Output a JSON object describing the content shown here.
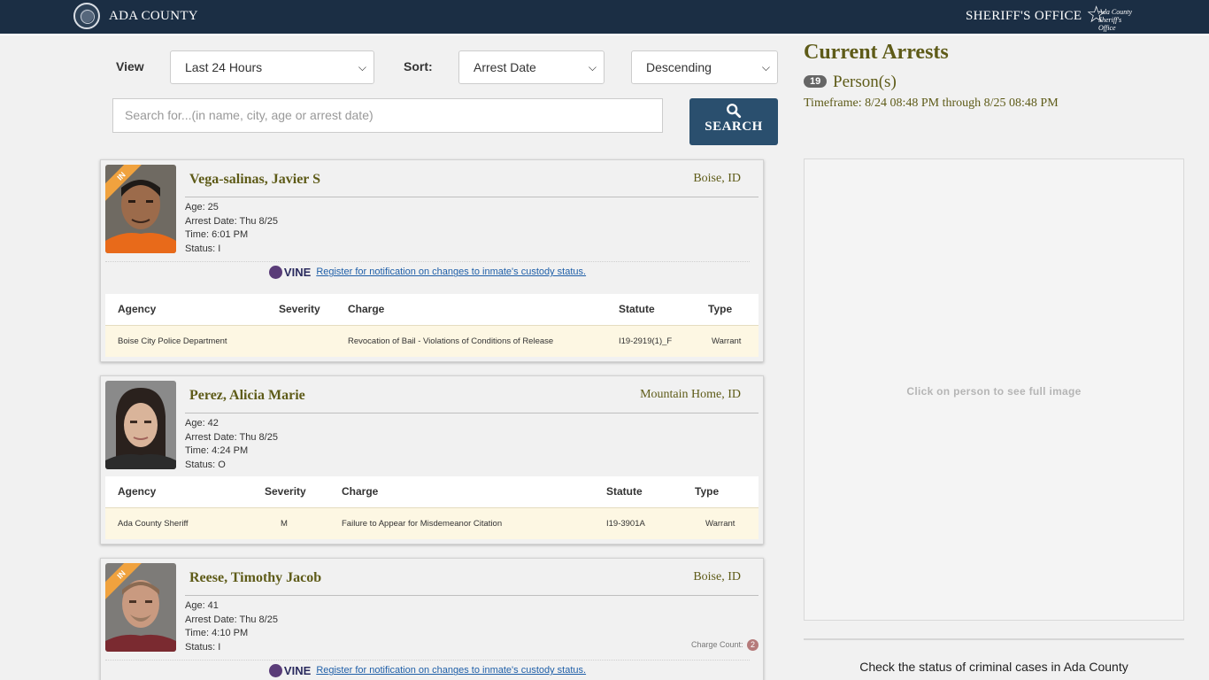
{
  "header": {
    "county": "ADA COUNTY",
    "office": "SHERIFF'S OFFICE",
    "logo_line1": "Ada County",
    "logo_line2": "Sheriff's Office"
  },
  "filters": {
    "view_label": "View",
    "view_value": "Last 24 Hours",
    "sort_label": "Sort:",
    "sort_value": "Arrest Date",
    "order_value": "Descending",
    "search_placeholder": "Search for...(in name, city, age or arrest date)",
    "search_button": "SEARCH"
  },
  "table_headers": {
    "agency": "Agency",
    "severity": "Severity",
    "charge": "Charge",
    "statute": "Statute",
    "type": "Type"
  },
  "vine": {
    "logo": "VINE",
    "link": " Register for notification on changes to inmate's custody status."
  },
  "arrests": [
    {
      "in_badge": "IN",
      "name": "Vega-salinas, Javier S",
      "city": "Boise, ID",
      "age": "Age: 25",
      "arrest_date": "Arrest Date: Thu 8/25",
      "time": "Time: 6:01 PM",
      "status": "Status: I",
      "charges": [
        {
          "agency": "Boise City Police Department",
          "severity": "",
          "charge": "Revocation of Bail - Violations of Conditions of Release",
          "statute": "I19-2919(1)_F",
          "type": "Warrant"
        }
      ]
    },
    {
      "in_badge": "",
      "name": "Perez, Alicia Marie",
      "city": "Mountain Home, ID",
      "age": "Age: 42",
      "arrest_date": "Arrest Date: Thu 8/25",
      "time": "Time: 4:24 PM",
      "status": "Status: O",
      "charges": [
        {
          "agency": "Ada County Sheriff",
          "severity": "M",
          "charge": "Failure to Appear for Misdemeanor Citation",
          "statute": "I19-3901A",
          "type": "Warrant"
        }
      ]
    },
    {
      "in_badge": "IN",
      "name": "Reese, Timothy Jacob",
      "city": "Boise, ID",
      "age": "Age: 41",
      "arrest_date": "Arrest Date: Thu 8/25",
      "time": "Time: 4:10 PM",
      "status": "Status: I",
      "charge_count_label": "Charge Count:",
      "charge_count": "2"
    }
  ],
  "summary": {
    "title": "Current Arrests",
    "count": "19",
    "persons_label": "Person(s)",
    "timeframe": "Timeframe: 8/24 08:48 PM through 8/25 08:48 PM"
  },
  "image_panel": {
    "hint": "Click on person to see full image"
  },
  "footer": {
    "check_status": "Check the status of criminal cases in Ada County"
  },
  "colors": {
    "header_bg": "#1b2e44",
    "accent_olive": "#5e5b18",
    "search_button": "#2a4f6e",
    "in_ribbon": "#f0a23e",
    "charge_row": "#fdf7e3"
  }
}
